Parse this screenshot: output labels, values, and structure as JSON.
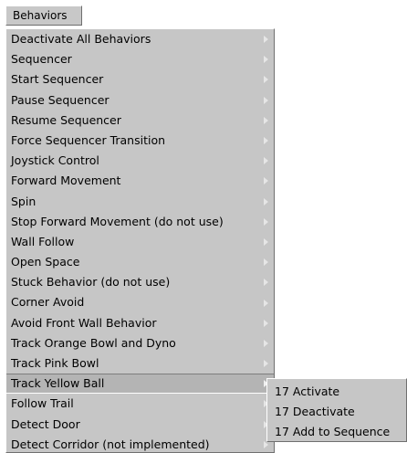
{
  "menubar": {
    "title": "Behaviors"
  },
  "menu": {
    "items": [
      {
        "label": "Deactivate All Behaviors"
      },
      {
        "label": "Sequencer"
      },
      {
        "label": "Start Sequencer"
      },
      {
        "label": "Pause Sequencer"
      },
      {
        "label": "Resume Sequencer"
      },
      {
        "label": "Force Sequencer Transition"
      },
      {
        "label": "Joystick Control"
      },
      {
        "label": "Forward Movement"
      },
      {
        "label": "Spin"
      },
      {
        "label": "Stop Forward Movement (do not use)"
      },
      {
        "label": "Wall Follow"
      },
      {
        "label": "Open Space"
      },
      {
        "label": "Stuck Behavior (do not use)"
      },
      {
        "label": "Corner Avoid"
      },
      {
        "label": "Avoid Front Wall Behavior"
      },
      {
        "label": "Track Orange Bowl and Dyno"
      },
      {
        "label": "Track Pink Bowl"
      },
      {
        "label": "Track Yellow Ball"
      },
      {
        "label": "Follow Trail"
      },
      {
        "label": "Detect Door"
      },
      {
        "label": "Detect Corridor (not implemented)"
      }
    ],
    "selected_label": "Track Yellow Ball"
  },
  "submenu": {
    "items": [
      {
        "label": "17 Activate"
      },
      {
        "label": "17 Deactivate"
      },
      {
        "label": "17 Add to Sequence"
      }
    ]
  },
  "colors": {
    "menu_background": "#c6c6c6",
    "selected_background": "#b4b4b4"
  }
}
